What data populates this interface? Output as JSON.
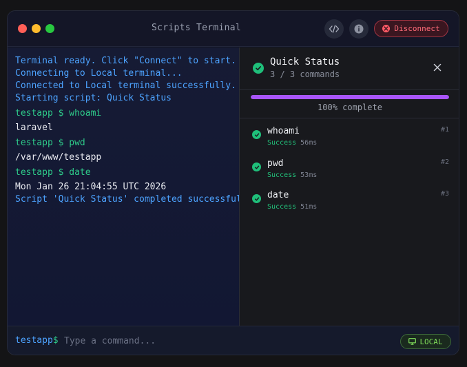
{
  "window": {
    "title": "Scripts Terminal"
  },
  "toolbar": {
    "disconnect_label": "Disconnect",
    "code_icon": "code-icon",
    "info_icon": "info-icon"
  },
  "terminal": {
    "lines": [
      "Terminal ready. Click \"Connect\" to start.",
      "Connecting to Local terminal...",
      "Connected to Local terminal successfully.",
      "Starting script: Quick Status",
      "testapp $ whoami",
      "laravel",
      "testapp $ pwd",
      "/var/www/testapp",
      "testapp $ date",
      "Mon Jan 26 21:04:55 UTC 2026",
      "Script 'Quick Status' completed successfully"
    ]
  },
  "panel": {
    "title": "Quick Status",
    "subtitle": "3 / 3 commands",
    "progress_fraction": 1.0,
    "progress_label": "100% complete",
    "steps": [
      {
        "name": "whoami",
        "status": "Success",
        "duration": "56ms",
        "index": "#1"
      },
      {
        "name": "pwd",
        "status": "Success",
        "duration": "53ms",
        "index": "#2"
      },
      {
        "name": "date",
        "status": "Success",
        "duration": "51ms",
        "index": "#3"
      }
    ]
  },
  "input": {
    "prompt_name": "testapp",
    "prompt_symbol": "$",
    "placeholder": "Type a command..."
  },
  "connection": {
    "label": "LOCAL"
  },
  "colors": {
    "info": "#4da3ff",
    "prompt": "#2ecb8a",
    "success": "#1fbf7a",
    "progress": "#a855f7",
    "danger": "#ff5a66"
  }
}
